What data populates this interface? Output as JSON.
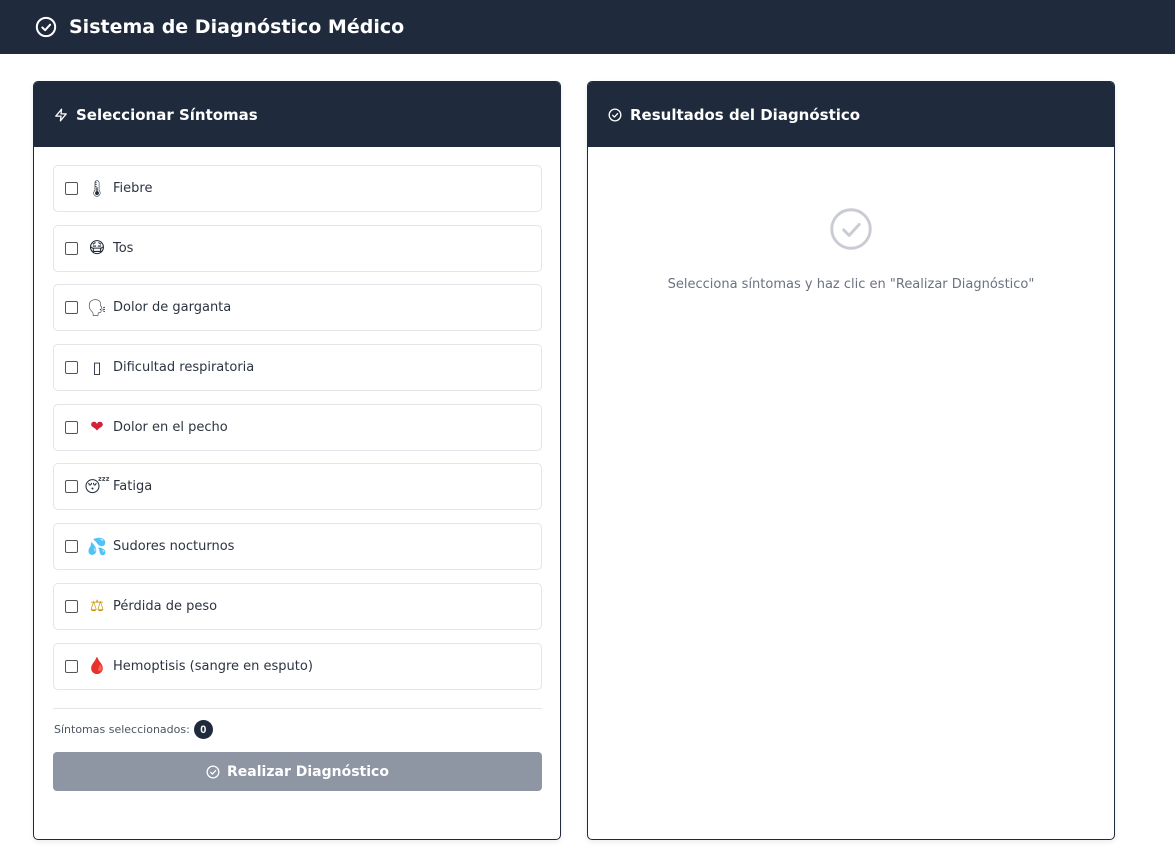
{
  "app": {
    "title": "Sistema de Diagnóstico Médico",
    "icon": "check-circle-icon"
  },
  "symptoms_panel": {
    "title": "Seleccionar Síntomas",
    "icon": "lightning-icon",
    "items": [
      {
        "emoji": "🌡",
        "icon": "thermometer-icon",
        "label": "Fiebre",
        "checked": false
      },
      {
        "emoji": "😷",
        "icon": "face-icon",
        "label": "Tos",
        "checked": false
      },
      {
        "emoji": "🗣",
        "icon": "speaking-head-icon",
        "label": "Dolor de garganta",
        "checked": false
      },
      {
        "emoji": "▯",
        "icon": "missing-glyph-icon",
        "label": "Dificultad respiratoria",
        "checked": false
      },
      {
        "emoji": "❤",
        "icon": "heart-icon",
        "label": "Dolor en el pecho",
        "checked": false
      },
      {
        "emoji": "😴",
        "icon": "sleepy-face-icon",
        "label": "Fatiga",
        "checked": false
      },
      {
        "emoji": "💦",
        "icon": "sweat-drops-icon",
        "label": "Sudores nocturnos",
        "checked": false
      },
      {
        "emoji": "⚖",
        "icon": "balance-scale-icon",
        "label": "Pérdida de peso",
        "checked": false
      },
      {
        "emoji": "🩸",
        "icon": "blood-drop-icon",
        "label": "Hemoptisis (sangre en esputo)",
        "checked": false
      }
    ],
    "selected_label": "Síntomas seleccionados:",
    "selected_count": "0",
    "button_label": "Realizar Diagnóstico",
    "button_icon": "check-circle-icon"
  },
  "results_panel": {
    "title": "Resultados del Diagnóstico",
    "icon": "check-circle-icon",
    "placeholder_icon": "check-circle-icon",
    "placeholder_text": "Selecciona síntomas y haz clic en \"Realizar Diagnóstico\""
  },
  "colors": {
    "header_bg": "#1f2a3c",
    "button_disabled": "#8f96a3",
    "border": "#e2e5ea",
    "muted_text": "#6b7280"
  }
}
